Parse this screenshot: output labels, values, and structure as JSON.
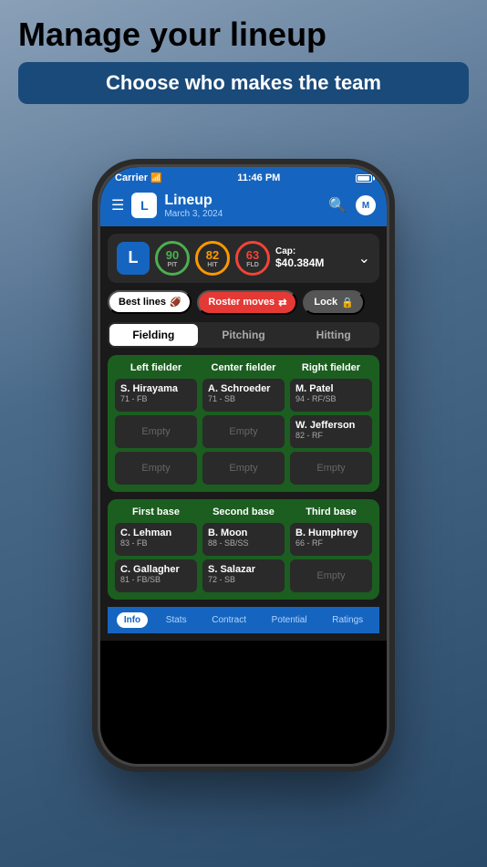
{
  "page": {
    "title": "Manage your lineup",
    "subtitle": "Choose who makes the team"
  },
  "status_bar": {
    "carrier": "Carrier",
    "time": "11:46 PM"
  },
  "nav": {
    "logo": "L",
    "title": "Lineup",
    "date": "March 3, 2024",
    "team_icon": "M"
  },
  "stats": {
    "logo": "L",
    "pit_label": "PIT",
    "pit_value": "90",
    "hit_label": "HIT",
    "hit_value": "82",
    "fld_label": "FLD",
    "fld_value": "63",
    "cap_label": "Cap:",
    "cap_value": "$40.384M"
  },
  "actions": {
    "best_lines": "Best lines",
    "roster_moves": "Roster moves",
    "lock": "Lock"
  },
  "tabs": {
    "fielding": "Fielding",
    "pitching": "Pitching",
    "hitting": "Hitting",
    "active": "fielding"
  },
  "outfield": {
    "left_fielder": {
      "header": "Left fielder",
      "players": [
        {
          "name": "S. Hirayama",
          "sub": "71 - FB"
        },
        {
          "name": "Empty",
          "sub": ""
        },
        {
          "name": "Empty",
          "sub": ""
        }
      ]
    },
    "center_fielder": {
      "header": "Center fielder",
      "players": [
        {
          "name": "A. Schroeder",
          "sub": "71 - SB"
        },
        {
          "name": "Empty",
          "sub": ""
        },
        {
          "name": "Empty",
          "sub": ""
        }
      ]
    },
    "right_fielder": {
      "header": "Right fielder",
      "players": [
        {
          "name": "M. Patel",
          "sub": "94 - RF/SB"
        },
        {
          "name": "W. Jefferson",
          "sub": "82 - RF"
        },
        {
          "name": "Empty",
          "sub": ""
        }
      ]
    }
  },
  "infield": {
    "first_base": {
      "header": "First base",
      "players": [
        {
          "name": "C. Lehman",
          "sub": "83 - FB"
        },
        {
          "name": "C. Gallagher",
          "sub": "81 - FB/SB"
        }
      ]
    },
    "second_base": {
      "header": "Second base",
      "players": [
        {
          "name": "B. Moon",
          "sub": "88 - SB/SS"
        },
        {
          "name": "S. Salazar",
          "sub": "72 - SB"
        }
      ]
    },
    "third_base": {
      "header": "Third base",
      "players": [
        {
          "name": "B. Humphrey",
          "sub": "66 - RF"
        },
        {
          "name": "Empty",
          "sub": ""
        }
      ]
    }
  },
  "bottom_tabs": [
    {
      "label": "Info",
      "active": true
    },
    {
      "label": "Stats",
      "active": false
    },
    {
      "label": "Contract",
      "active": false
    },
    {
      "label": "Potential",
      "active": false
    },
    {
      "label": "Ratings",
      "active": false
    }
  ]
}
